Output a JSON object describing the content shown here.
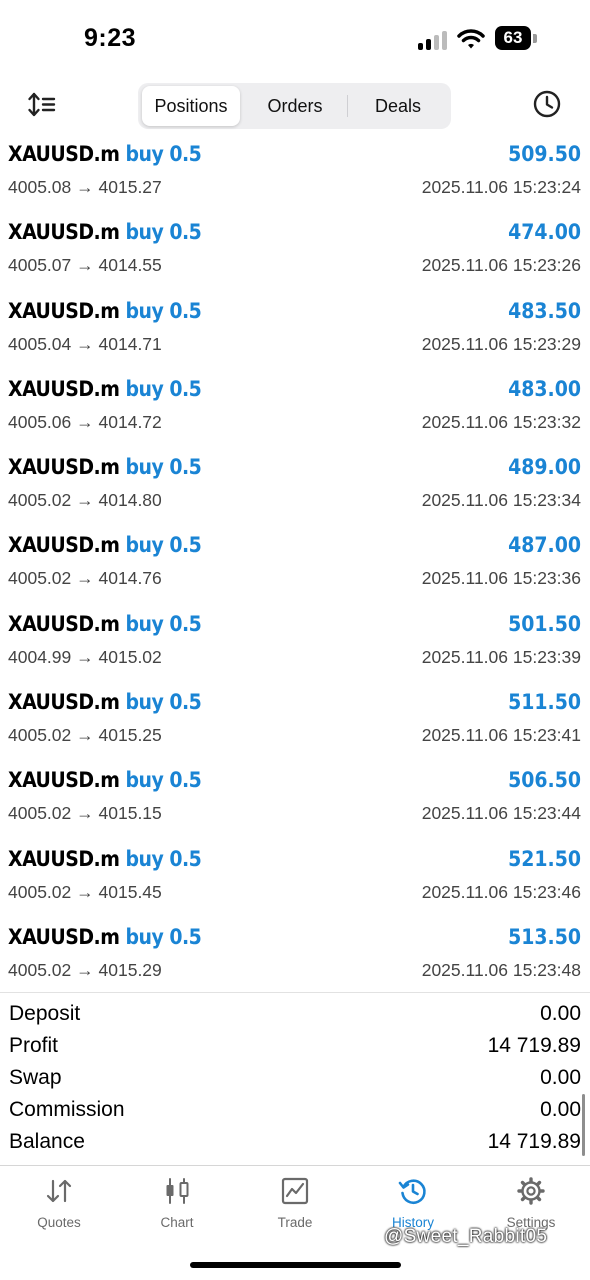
{
  "status_bar": {
    "time": "9:23",
    "battery": "63"
  },
  "toolbar": {
    "tabs": [
      {
        "label": "Positions",
        "active": true
      },
      {
        "label": "Orders",
        "active": false
      },
      {
        "label": "Deals",
        "active": false
      }
    ]
  },
  "deals": [
    {
      "symbol": "XAUUSD.m",
      "side": "buy 0.5",
      "open": "4005.08",
      "close": "4015.27",
      "profit": "509.50",
      "time": "2025.11.06 15:23:24"
    },
    {
      "symbol": "XAUUSD.m",
      "side": "buy 0.5",
      "open": "4005.07",
      "close": "4014.55",
      "profit": "474.00",
      "time": "2025.11.06 15:23:26"
    },
    {
      "symbol": "XAUUSD.m",
      "side": "buy 0.5",
      "open": "4005.04",
      "close": "4014.71",
      "profit": "483.50",
      "time": "2025.11.06 15:23:29"
    },
    {
      "symbol": "XAUUSD.m",
      "side": "buy 0.5",
      "open": "4005.06",
      "close": "4014.72",
      "profit": "483.00",
      "time": "2025.11.06 15:23:32"
    },
    {
      "symbol": "XAUUSD.m",
      "side": "buy 0.5",
      "open": "4005.02",
      "close": "4014.80",
      "profit": "489.00",
      "time": "2025.11.06 15:23:34"
    },
    {
      "symbol": "XAUUSD.m",
      "side": "buy 0.5",
      "open": "4005.02",
      "close": "4014.76",
      "profit": "487.00",
      "time": "2025.11.06 15:23:36"
    },
    {
      "symbol": "XAUUSD.m",
      "side": "buy 0.5",
      "open": "4004.99",
      "close": "4015.02",
      "profit": "501.50",
      "time": "2025.11.06 15:23:39"
    },
    {
      "symbol": "XAUUSD.m",
      "side": "buy 0.5",
      "open": "4005.02",
      "close": "4015.25",
      "profit": "511.50",
      "time": "2025.11.06 15:23:41"
    },
    {
      "symbol": "XAUUSD.m",
      "side": "buy 0.5",
      "open": "4005.02",
      "close": "4015.15",
      "profit": "506.50",
      "time": "2025.11.06 15:23:44"
    },
    {
      "symbol": "XAUUSD.m",
      "side": "buy 0.5",
      "open": "4005.02",
      "close": "4015.45",
      "profit": "521.50",
      "time": "2025.11.06 15:23:46"
    },
    {
      "symbol": "XAUUSD.m",
      "side": "buy 0.5",
      "open": "4005.02",
      "close": "4015.29",
      "profit": "513.50",
      "time": "2025.11.06 15:23:48"
    }
  ],
  "summary": [
    {
      "label": "Deposit",
      "value": "0.00"
    },
    {
      "label": "Profit",
      "value": "14 719.89"
    },
    {
      "label": "Swap",
      "value": "0.00"
    },
    {
      "label": "Commission",
      "value": "0.00"
    },
    {
      "label": "Balance",
      "value": "14 719.89"
    }
  ],
  "nav": [
    {
      "label": "Quotes",
      "icon": "quotes-icon",
      "active": false
    },
    {
      "label": "Chart",
      "icon": "chart-icon",
      "active": false
    },
    {
      "label": "Trade",
      "icon": "trade-icon",
      "active": false
    },
    {
      "label": "History",
      "icon": "history-icon",
      "active": true
    },
    {
      "label": "Settings",
      "icon": "settings-icon",
      "active": false
    }
  ],
  "watermark": "@Sweet_Rabbit05",
  "colors": {
    "accent": "#1a84d4",
    "secondary_text": "#444444",
    "nav_inactive": "#6a6a6a"
  }
}
